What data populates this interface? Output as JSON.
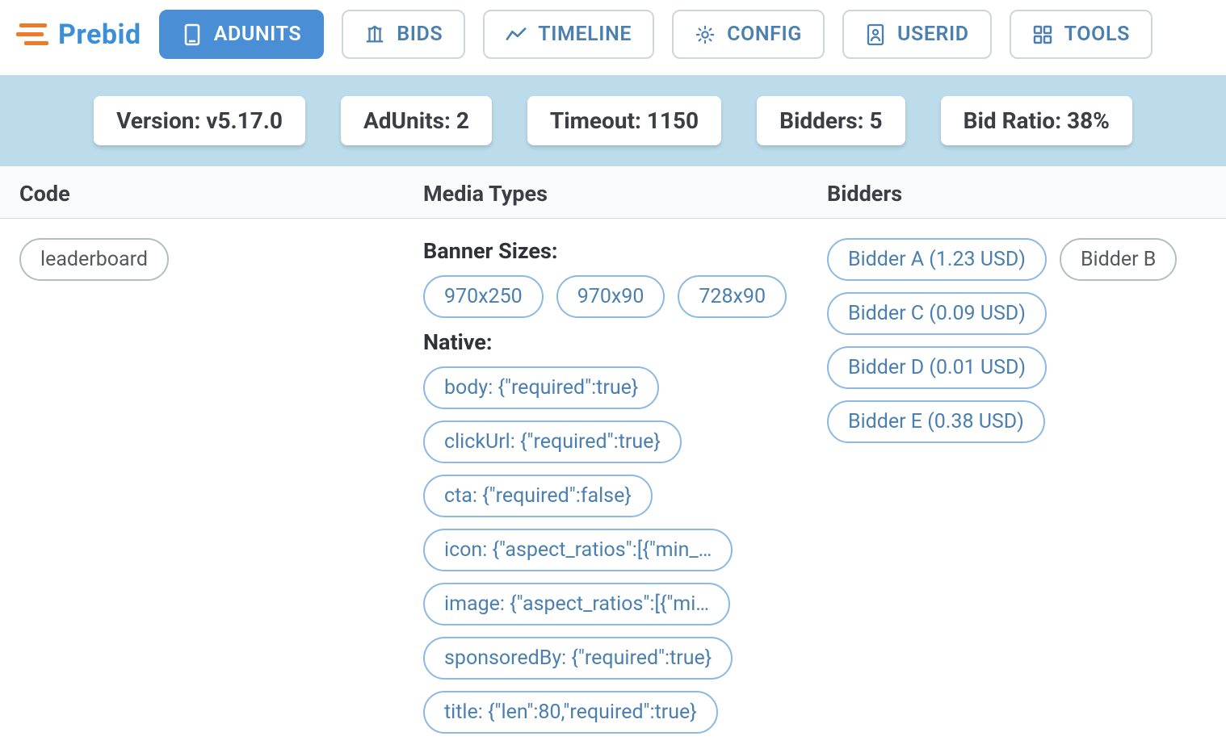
{
  "brand": {
    "name": "Prebid"
  },
  "nav": {
    "adunits": "ADUNITS",
    "bids": "BIDS",
    "timeline": "TIMELINE",
    "config": "CONFIG",
    "userid": "USERID",
    "tools": "TOOLS"
  },
  "stats": {
    "version": "Version: v5.17.0",
    "adunits": "AdUnits: 2",
    "timeout": "Timeout: 1150",
    "bidders": "Bidders: 5",
    "bidratio": "Bid Ratio: 38%"
  },
  "columns": {
    "code": "Code",
    "media_types": "Media Types",
    "bidders": "Bidders"
  },
  "row": {
    "code": "leaderboard",
    "banner_label": "Banner Sizes:",
    "banner_sizes": [
      "970x250",
      "970x90",
      "728x90"
    ],
    "native_label": "Native:",
    "native_props": [
      "body: {\"required\":true}",
      "clickUrl: {\"required\":true}",
      "cta: {\"required\":false}",
      "icon: {\"aspect_ratios\":[{\"min_…",
      "image: {\"aspect_ratios\":[{\"mi…",
      "sponsoredBy: {\"required\":true}",
      "title: {\"len\":80,\"required\":true}"
    ],
    "bidders": [
      {
        "label": "Bidder A (1.23 USD)",
        "hasBid": true
      },
      {
        "label": "Bidder B",
        "hasBid": false
      },
      {
        "label": "Bidder C (0.09 USD)",
        "hasBid": true
      },
      {
        "label": "Bidder D (0.01 USD)",
        "hasBid": true
      },
      {
        "label": "Bidder E (0.38 USD)",
        "hasBid": true
      }
    ]
  }
}
